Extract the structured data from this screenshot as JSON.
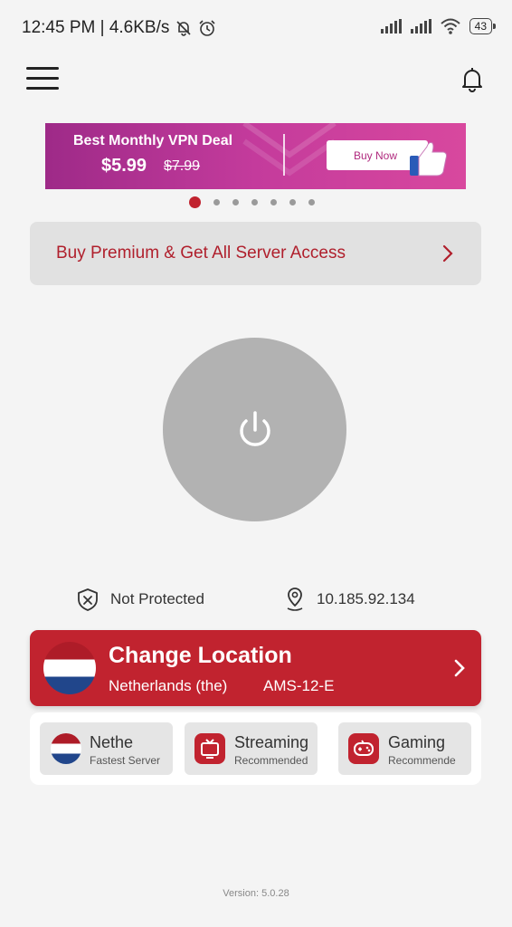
{
  "status_bar": {
    "time_speed": "12:45 PM | 4.6KB/s",
    "battery": "43"
  },
  "banner": {
    "title": "Best Monthly VPN Deal",
    "price": "$5.99",
    "old_price": "$7.99",
    "button": "Buy Now",
    "colors": {
      "start": "#9e2a88",
      "end": "#d8489e"
    }
  },
  "carousel": {
    "count": 7,
    "active": 0
  },
  "premium": {
    "label": "Buy Premium & Get All Server Access"
  },
  "connection": {
    "status": "Not Protected",
    "ip": "10.185.92.134"
  },
  "location": {
    "title": "Change Location",
    "country": "Netherlands (the)",
    "server": "AMS-12-E"
  },
  "quick_options": [
    {
      "title": "Nethe",
      "subtitle": "Fastest Server",
      "icon": "netherlands-flag-icon"
    },
    {
      "title": "Streaming",
      "subtitle": "Recommended",
      "icon": "tv-icon"
    },
    {
      "title": "Gaming",
      "subtitle": "Recommende",
      "icon": "gamepad-icon"
    }
  ],
  "version": "Version: 5.0.28",
  "theme": {
    "accent": "#c1232f",
    "background": "#f4f4f4"
  }
}
